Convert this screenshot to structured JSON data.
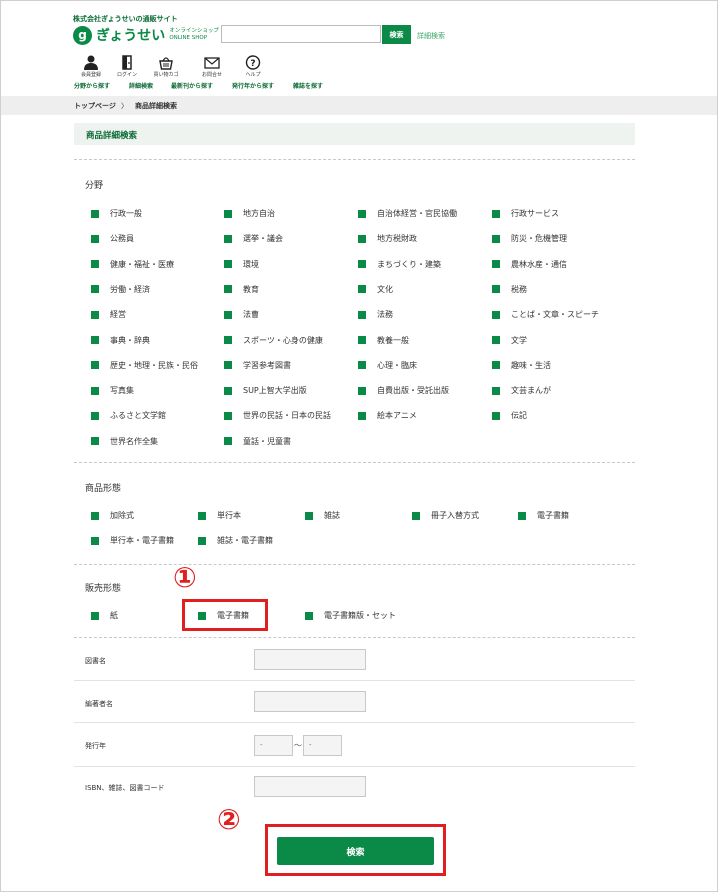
{
  "header": {
    "company": "株式会社ぎょうせいの通販サイト",
    "logo_mark": "g",
    "logo_text": "ぎょうせい",
    "logo_sub1": "オンラインショップ",
    "logo_sub2": "ONLINE SHOP",
    "search_placeholder": "",
    "search_button": "検索",
    "advanced_link": "詳細検索"
  },
  "nav_icons": [
    {
      "label": "会員登録",
      "icon": "person-icon"
    },
    {
      "label": "ログイン",
      "icon": "door-icon"
    },
    {
      "label": "買い物カゴ",
      "icon": "basket-icon"
    },
    {
      "label": "お問合せ",
      "icon": "mail-icon"
    },
    {
      "label": "ヘルプ",
      "icon": "help-icon"
    }
  ],
  "nav_links": [
    "分野から探す",
    "詳細検索",
    "最新刊から探す",
    "発行年から探す",
    "雑誌を探す"
  ],
  "breadcrumb": {
    "home": "トップページ",
    "sep": "〉",
    "current": "商品詳細検索"
  },
  "page_title": "商品詳細検索",
  "fields_section": {
    "label": "分野",
    "items": [
      "行政一般",
      "地方自治",
      "自治体経営・官民協働",
      "行政サービス",
      "公務員",
      "選挙・議会",
      "地方税財政",
      "防災・危機管理",
      "健康・福祉・医療",
      "環境",
      "まちづくり・建築",
      "農林水産・通信",
      "労働・経済",
      "教育",
      "文化",
      "税務",
      "経営",
      "法曹",
      "法務",
      "ことば・文章・スピーチ",
      "事典・辞典",
      "スポーツ・心身の健康",
      "教養一般",
      "文学",
      "歴史・地理・民族・民俗",
      "学習参考図書",
      "心理・臨床",
      "趣味・生活",
      "写真集",
      "SUP上智大学出版",
      "自費出版・受託出版",
      "文芸まんが",
      "ふるさと文学館",
      "世界の民話・日本の民話",
      "絵本アニメ",
      "伝記",
      "世界名作全集",
      "童話・児童書"
    ]
  },
  "format_section": {
    "label": "商品形態",
    "items": [
      "加除式",
      "単行本",
      "雑誌",
      "冊子入替方式",
      "電子書籍",
      "単行本・電子書籍",
      "雑誌・電子書籍"
    ]
  },
  "sales_section": {
    "label": "販売形態",
    "items": [
      "紙",
      "電子書籍",
      "電子書籍版・セット"
    ]
  },
  "form": {
    "title_label": "図書名",
    "author_label": "編著者名",
    "year_label": "発行年",
    "year_from": "-",
    "year_to": "-",
    "year_sep": "～",
    "isbn_label": "ISBN、雑誌、図書コード"
  },
  "submit_label": "検索",
  "annotations": {
    "marker1": "①",
    "marker2": "②"
  },
  "colors": {
    "brand": "#0a8a46",
    "annotation": "#e02020"
  }
}
